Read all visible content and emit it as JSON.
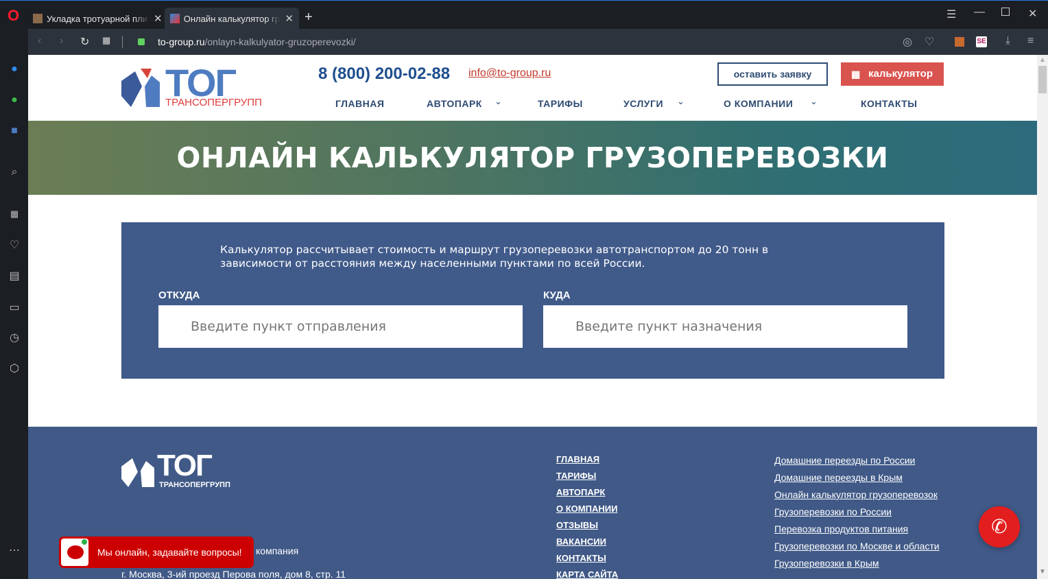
{
  "browser": {
    "tabs": [
      {
        "title": "Укладка тротуарной плитки"
      },
      {
        "title": "Онлайн калькулятор грузоперевозки"
      }
    ],
    "url_domain": "to-group.ru",
    "url_path": "/onlayn-kalkulyator-gruzoperevozki/"
  },
  "header": {
    "logo_text": "ТОГ",
    "logo_sub": "ТРАНСОПЕРГРУПП",
    "phone": "8 (800) 200-02-88",
    "email": "info@to-group.ru",
    "request_button": "оставить заявку",
    "calc_button": "калькулятор",
    "nav": [
      "ГЛАВНАЯ",
      "АВТОПАРК",
      "ТАРИФЫ",
      "УСЛУГИ",
      "О КОМПАНИИ",
      "КОНТАКТЫ"
    ]
  },
  "hero": {
    "title": "ОНЛАЙН КАЛЬКУЛЯТОР ГРУЗОПЕРЕВОЗКИ"
  },
  "calculator": {
    "description": "Калькулятор рассчитывает стоимость и маршрут грузоперевозки автотранспортом до 20 тонн в зависимости от расстояния между населенными пунктами по всей России.",
    "from_label": "ОТКУДА",
    "from_placeholder": "Введите пункт отправления",
    "to_label": "КУДА",
    "to_placeholder": "Введите пункт назначения"
  },
  "footer": {
    "company_text": "компания",
    "address": "г. Москва, 3-ий проезд Перова поля, дом 8, стр. 11",
    "menu": [
      "ГЛАВНАЯ",
      "ТАРИФЫ",
      "АВТОПАРК",
      "О КОМПАНИИ",
      "ОТЗЫВЫ",
      "ВАКАНСИИ",
      "КОНТАКТЫ",
      "КАРТА САЙТА"
    ],
    "links": [
      "Домашние переезды по России",
      "Домашние переезды в Крым",
      "Онлайн калькулятор грузоперевозок",
      "Грузоперевозки по России",
      "Перевозка продуктов питания",
      "Грузоперевозки по Москве и области",
      "Грузоперевозки в Крым"
    ]
  },
  "chat": {
    "text": "Мы онлайн, задавайте вопросы!"
  },
  "colors": {
    "brand_blue": "#405a8a",
    "accent_red": "#d9534f",
    "call_red": "#e31e1e"
  }
}
